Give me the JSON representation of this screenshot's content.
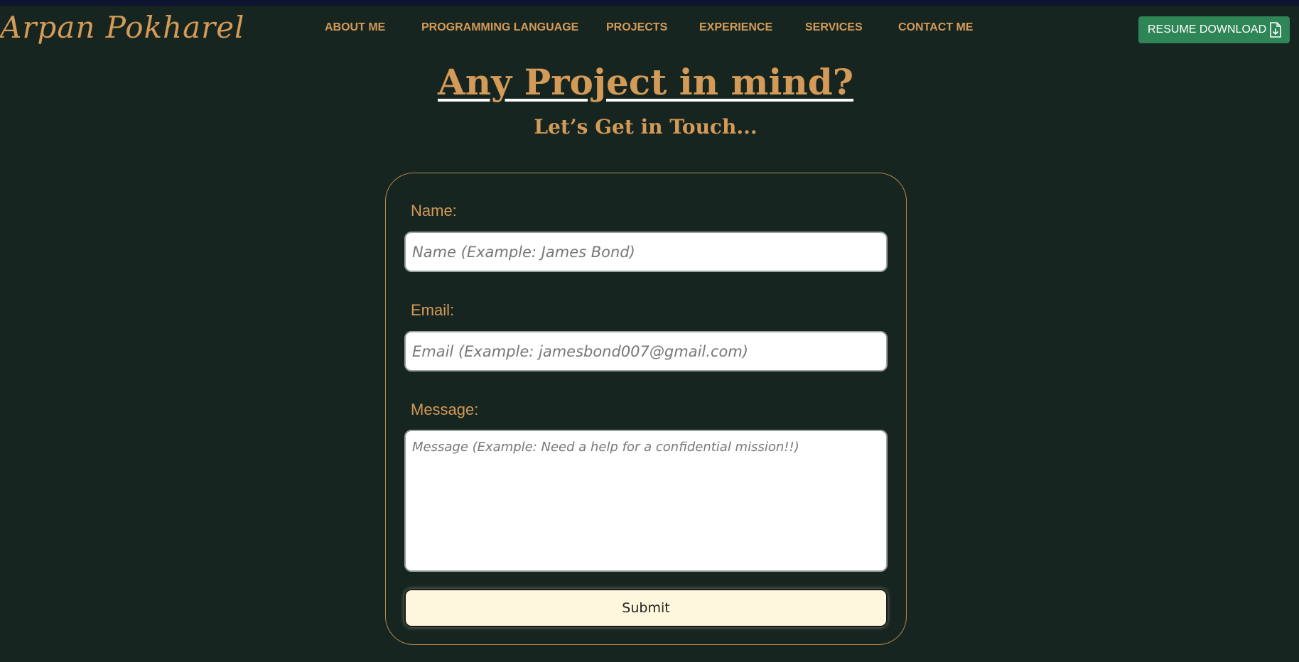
{
  "brand": {
    "logo_text": "Arpan Pokharel",
    "accent_color": "#d49a57",
    "background_color": "#172520"
  },
  "nav": {
    "items": [
      {
        "label": "ABOUT ME"
      },
      {
        "label": "PROGRAMMING LANGUAGE"
      },
      {
        "label": "PROJECTS"
      },
      {
        "label": "EXPERIENCE"
      },
      {
        "label": "SERVICES"
      },
      {
        "label": "CONTACT ME"
      }
    ]
  },
  "resume_button": {
    "label": "RESUME DOWNLOAD",
    "icon": "file-download-icon",
    "color": "#2e8556"
  },
  "hero": {
    "title": "Any Project in mind?",
    "subtitle": "Let’s Get in Touch..."
  },
  "form": {
    "name_label": "Name:",
    "name_placeholder": "Name (Example: James Bond)",
    "email_label": "Email:",
    "email_placeholder": "Email (Example: jamesbond007@gmail.com)",
    "message_label": "Message:",
    "message_placeholder": "Message (Example: Need a help for a confidential mission!!)",
    "submit_label": "Submit"
  }
}
